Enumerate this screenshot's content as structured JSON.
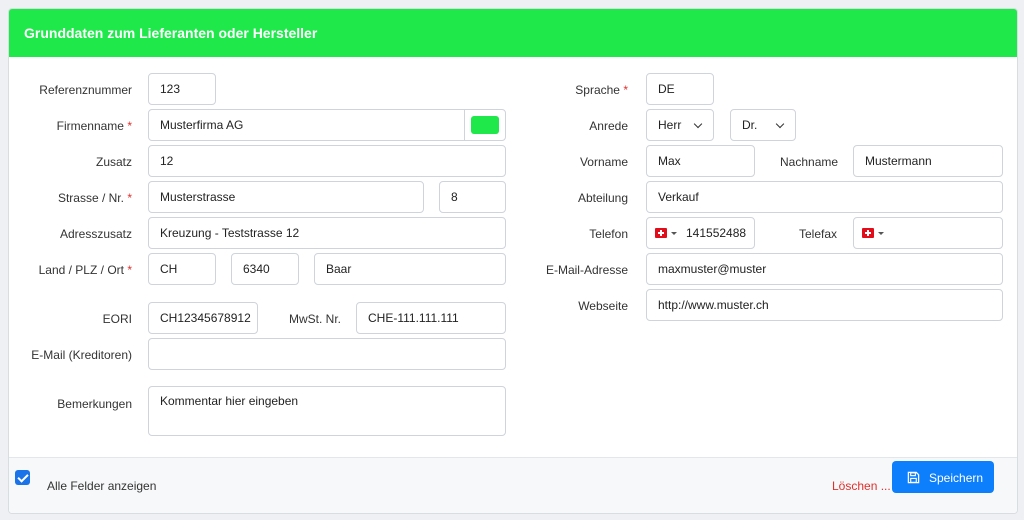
{
  "header": {
    "title": "Grunddaten zum Lieferanten oder Hersteller"
  },
  "colors": {
    "header_bg": "#1fe84b",
    "color_swatch": "#1fe84b",
    "primary": "#0d7efc",
    "danger": "#e0302b"
  },
  "left": {
    "referenznummer": {
      "label": "Referenznummer",
      "value": "123"
    },
    "firmenname": {
      "label": "Firmenname",
      "value": "Musterfirma AG",
      "swatch_icon": "color-swatch"
    },
    "zusatz": {
      "label": "Zusatz",
      "value": "12"
    },
    "strasse": {
      "label": "Strasse / Nr.",
      "street": "Musterstrasse",
      "number": "8"
    },
    "adresszusatz": {
      "label": "Adresszusatz",
      "value": "Kreuzung - Teststrasse 12"
    },
    "land": {
      "label": "Land / PLZ / Ort",
      "country": "CH",
      "plz": "6340",
      "ort": "Baar"
    },
    "eori": {
      "label": "EORI",
      "value": "CH12345678912"
    },
    "mwst": {
      "label": "MwSt. Nr.",
      "value": "CHE-111.111.111"
    },
    "email_kreditoren": {
      "label": "E-Mail (Kreditoren)",
      "value": ""
    },
    "bemerkungen": {
      "label": "Bemerkungen",
      "value": "Kommentar hier eingeben"
    }
  },
  "right": {
    "sprache": {
      "label": "Sprache",
      "value": "DE"
    },
    "anrede": {
      "label": "Anrede",
      "value": "Herr",
      "title": "Dr."
    },
    "vorname": {
      "label": "Vorname",
      "value": "Max"
    },
    "nachname": {
      "label": "Nachname",
      "value": "Mustermann"
    },
    "abteilung": {
      "label": "Abteilung",
      "value": "Verkauf"
    },
    "telefon": {
      "label": "Telefon",
      "value": "141552488"
    },
    "telefax": {
      "label": "Telefax",
      "value": ""
    },
    "email": {
      "label": "E-Mail-Adresse",
      "value": "maxmuster@muster"
    },
    "webseite": {
      "label": "Webseite",
      "value": "http://www.muster.ch"
    }
  },
  "footer": {
    "show_all_label": "Alle Felder anzeigen",
    "show_all_checked": true,
    "delete_label": "Löschen ...",
    "save_label": "Speichern"
  }
}
